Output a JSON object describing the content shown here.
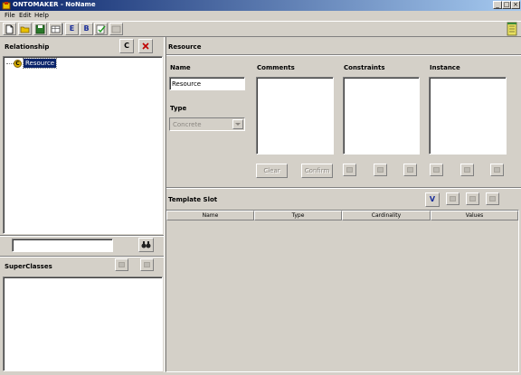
{
  "window": {
    "title": "ONTOMAKER - NoName"
  },
  "menu": {
    "items": [
      "File",
      "Edit",
      "Help"
    ]
  },
  "toolbar": {
    "buttons": [
      {
        "name": "new-icon",
        "label": ""
      },
      {
        "name": "open-icon",
        "label": ""
      },
      {
        "name": "save-icon",
        "label": ""
      },
      {
        "name": "table-icon",
        "label": ""
      },
      {
        "name": "e-button",
        "label": "E"
      },
      {
        "name": "b-button",
        "label": "B"
      },
      {
        "name": "check-icon",
        "label": ""
      },
      {
        "name": "grid-icon",
        "label": ""
      }
    ]
  },
  "left": {
    "relationship_label": "Relationship",
    "class_button": "C",
    "tree": {
      "root_badge": "C",
      "root_label": "Resource"
    },
    "search": {
      "value": "",
      "placeholder": ""
    },
    "superclasses_label": "SuperClasses"
  },
  "right": {
    "title": "Resource",
    "name_label": "Name",
    "name_value": "Resource",
    "type_label": "Type",
    "type_value": "Concrete",
    "comments_label": "Comments",
    "constraints_label": "Constraints",
    "instance_label": "Instance",
    "clear_button": "Clear",
    "confirm_button": "Confirm",
    "template_slot_label": "Template Slot",
    "v_button": "V",
    "columns": [
      "Name",
      "Type",
      "Cardinality",
      "Values"
    ]
  },
  "colors": {
    "titlebar_start": "#0a246a",
    "titlebar_end": "#a6caf0",
    "selection": "#0a246a"
  }
}
